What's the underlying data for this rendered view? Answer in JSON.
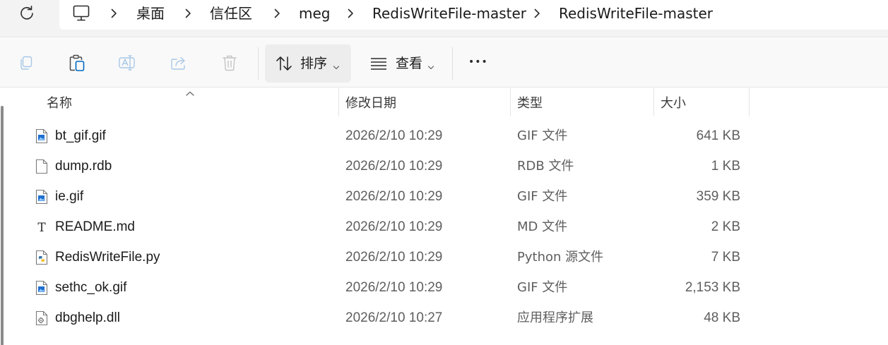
{
  "address": {
    "crumbs": [
      "桌面",
      "信任区",
      "meg",
      "RedisWriteFile-master",
      "RedisWriteFile-master"
    ]
  },
  "toolbar": {
    "sort_label": "排序",
    "view_label": "查看",
    "more_label": "•••"
  },
  "columns": {
    "name": "名称",
    "date": "修改日期",
    "type": "类型",
    "size": "大小"
  },
  "files": [
    {
      "name": "bt_gif.gif",
      "date": "2026/2/10 10:29",
      "type": "GIF 文件",
      "size": "641 KB",
      "icon": "image-file-icon"
    },
    {
      "name": "dump.rdb",
      "date": "2026/2/10 10:29",
      "type": "RDB 文件",
      "size": "1 KB",
      "icon": "blank-file-icon"
    },
    {
      "name": "ie.gif",
      "date": "2026/2/10 10:29",
      "type": "GIF 文件",
      "size": "359 KB",
      "icon": "image-file-icon"
    },
    {
      "name": "README.md",
      "date": "2026/2/10 10:29",
      "type": "MD 文件",
      "size": "2 KB",
      "icon": "text-file-icon"
    },
    {
      "name": "RedisWriteFile.py",
      "date": "2026/2/10 10:29",
      "type": "Python 源文件",
      "size": "7 KB",
      "icon": "python-file-icon"
    },
    {
      "name": "sethc_ok.gif",
      "date": "2026/2/10 10:29",
      "type": "GIF 文件",
      "size": "2,153 KB",
      "icon": "image-file-icon"
    },
    {
      "name": "dbghelp.dll",
      "date": "2026/2/10 10:27",
      "type": "应用程序扩展",
      "size": "48 KB",
      "icon": "dll-file-icon"
    }
  ],
  "colors": {
    "accent": "#0067c0",
    "address_bg": "#f3f3f3",
    "toolbar_bg": "#f9f9f9",
    "sort_button_bg": "#ededed"
  }
}
